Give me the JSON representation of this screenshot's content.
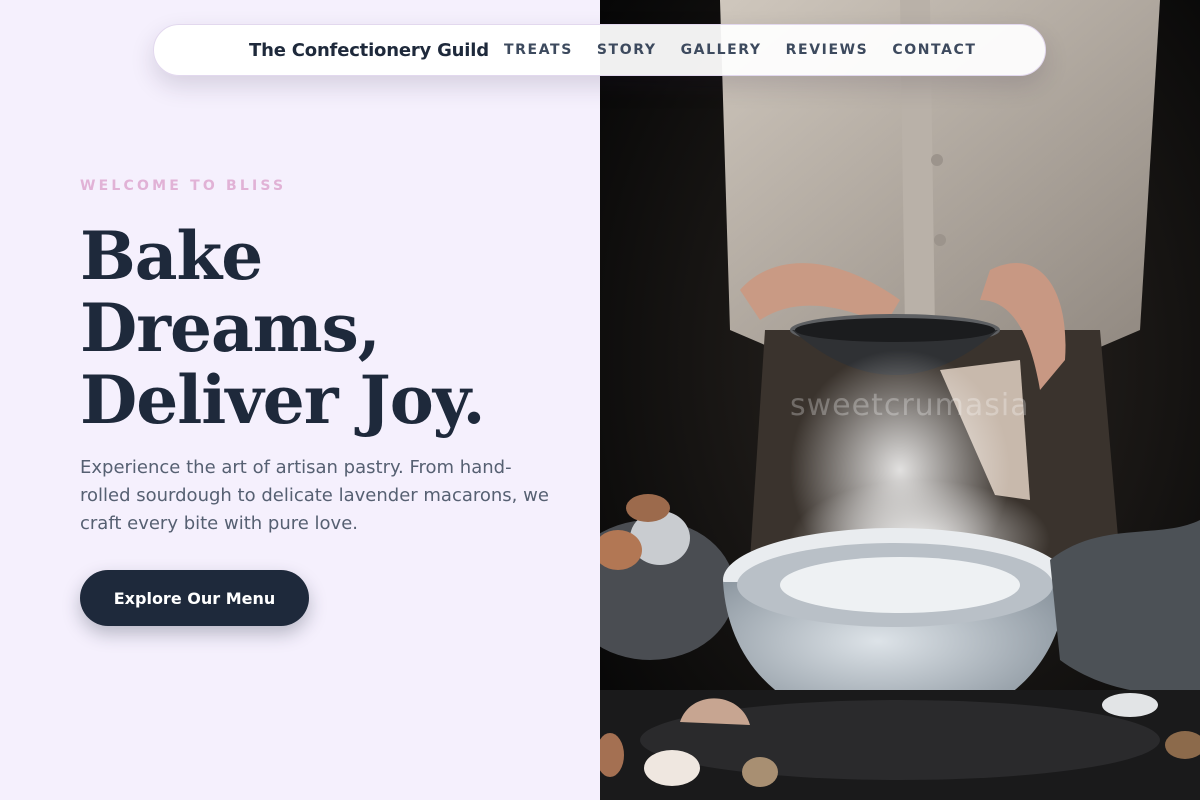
{
  "nav": {
    "brand": "The Confectionery Guild",
    "links": [
      "TREATS",
      "STORY",
      "GALLERY",
      "REVIEWS",
      "CONTACT"
    ]
  },
  "hero": {
    "eyebrow": "WELCOME TO BLISS",
    "headline_lines": [
      "Bake",
      "Dreams,",
      "Deliver Joy."
    ],
    "description": "Experience the art of artisan pastry. From hand-rolled sourdough to delicate lavender macarons, we craft every bite with pure love.",
    "cta_label": "Explore Our Menu"
  },
  "photo": {
    "watermark": "sweetcrumasia"
  },
  "colors": {
    "page_bg": "#f5f0fd",
    "accent_pink": "#e1b2d6",
    "ink": "#1e293b",
    "muted": "#566072"
  }
}
